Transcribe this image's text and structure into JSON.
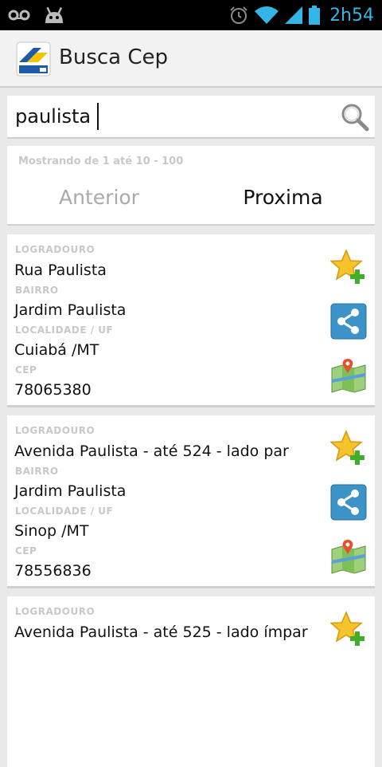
{
  "status_bar": {
    "time": "2h54",
    "icons": [
      "voicemail-icon",
      "android-debug-icon",
      "alarm-icon",
      "wifi-icon",
      "signal-icon",
      "battery-icon"
    ]
  },
  "action_bar": {
    "title": "Busca Cep",
    "logo_icon": "app-logo-icon"
  },
  "search": {
    "value": "paulista",
    "icon": "search-icon"
  },
  "pager": {
    "info": "Mostrando de 1 até 10 - 100",
    "prev_label": "Anterior",
    "next_label": "Proxima"
  },
  "results": [
    {
      "logradouro_label": "LOGRADOURO",
      "logradouro": "Rua Paulista",
      "bairro_label": "BAIRRO",
      "bairro": "Jardim Paulista",
      "localidade_label": "LOCALIDADE / UF",
      "localidade": "Cuiabá /MT",
      "cep_label": "CEP",
      "cep": "78065380"
    },
    {
      "logradouro_label": "LOGRADOURO",
      "logradouro": "Avenida Paulista - até 524 - lado par",
      "bairro_label": "BAIRRO",
      "bairro": "Jardim Paulista",
      "localidade_label": "LOCALIDADE / UF",
      "localidade": "Sinop /MT",
      "cep_label": "CEP",
      "cep": "78556836"
    },
    {
      "logradouro_label": "LOGRADOURO",
      "logradouro": "Avenida Paulista - até 525 - lado ímpar"
    }
  ],
  "colors": {
    "status_accent": "#33b5e5",
    "background": "#e9e9e9",
    "label_gray": "#c8c8c8"
  }
}
